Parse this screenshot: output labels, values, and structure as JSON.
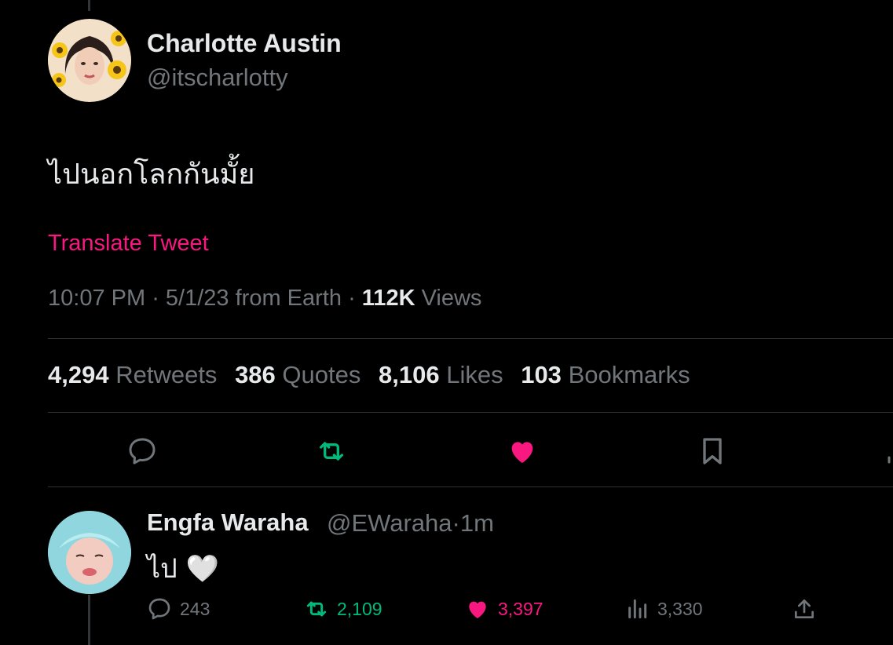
{
  "tweet": {
    "author_name": "Charlotte Austin",
    "author_handle": "@itscharlotty",
    "text": "ไปนอกโลกกันมั้ย",
    "translate_label": "Translate Tweet",
    "time": "10:07 PM",
    "date": "5/1/23",
    "source": "from Earth",
    "views_count": "112K",
    "views_label": "Views"
  },
  "stats": [
    {
      "count": "4,294",
      "label": "Retweets"
    },
    {
      "count": "386",
      "label": "Quotes"
    },
    {
      "count": "8,106",
      "label": "Likes"
    },
    {
      "count": "103",
      "label": "Bookmarks"
    }
  ],
  "actions": [
    {
      "icon": "reply-icon",
      "color": "#71767b"
    },
    {
      "icon": "retweet-icon",
      "color": "#00ba7c"
    },
    {
      "icon": "heart-filled-icon",
      "color": "#f91880"
    },
    {
      "icon": "bookmark-icon",
      "color": "#71767b"
    }
  ],
  "reply": {
    "author_name": "Engfa Waraha",
    "author_handle": "@EWaraha",
    "separator": "·",
    "time_ago": "1m",
    "text": "ไป 🤍",
    "reply_count": "243",
    "retweet_count": "2,109",
    "like_count": "3,397",
    "view_count": "3,330"
  },
  "colors": {
    "background": "#000000",
    "text_primary": "#e7e9ea",
    "text_secondary": "#71767b",
    "accent_pink": "#f91880",
    "accent_green": "#00ba7c",
    "divider": "#2f3336"
  }
}
